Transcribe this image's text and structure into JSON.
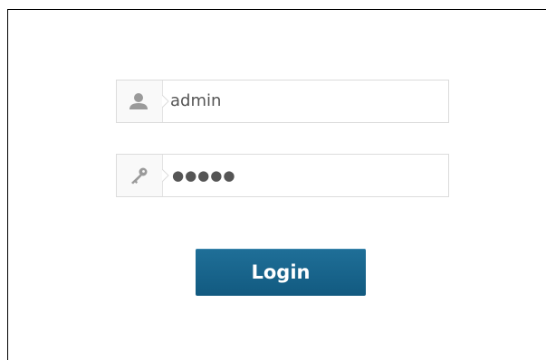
{
  "login_form": {
    "username": {
      "value": "admin",
      "icon": "user-icon"
    },
    "password": {
      "masked_value": "●●●●●",
      "icon": "key-icon"
    },
    "login_button": {
      "label": "Login",
      "color": "#1a6690"
    }
  }
}
